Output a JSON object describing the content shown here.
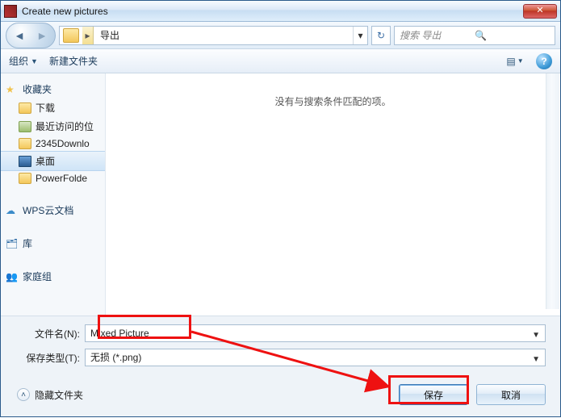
{
  "window": {
    "title": "Create new pictures"
  },
  "nav": {
    "path_segment": "导出",
    "search_placeholder": "搜索 导出"
  },
  "toolbar": {
    "organize": "组织",
    "newfolder": "新建文件夹"
  },
  "sidebar": {
    "favorites": {
      "label": "收藏夹"
    },
    "items": [
      {
        "label": "下载"
      },
      {
        "label": "最近访问的位"
      },
      {
        "label": "2345Downlo"
      },
      {
        "label": "桌面"
      },
      {
        "label": "PowerFolde"
      }
    ],
    "cloud": {
      "label": "WPS云文档"
    },
    "library": {
      "label": "库"
    },
    "homegroup": {
      "label": "家庭组"
    }
  },
  "content": {
    "empty_text": "没有与搜索条件匹配的项。"
  },
  "footer": {
    "filename_label": "文件名(N):",
    "filename_value": "Mixed Picture",
    "type_label": "保存类型(T):",
    "type_value": "无损 (*.png)",
    "hide_label": "隐藏文件夹",
    "save": "保存",
    "cancel": "取消"
  }
}
